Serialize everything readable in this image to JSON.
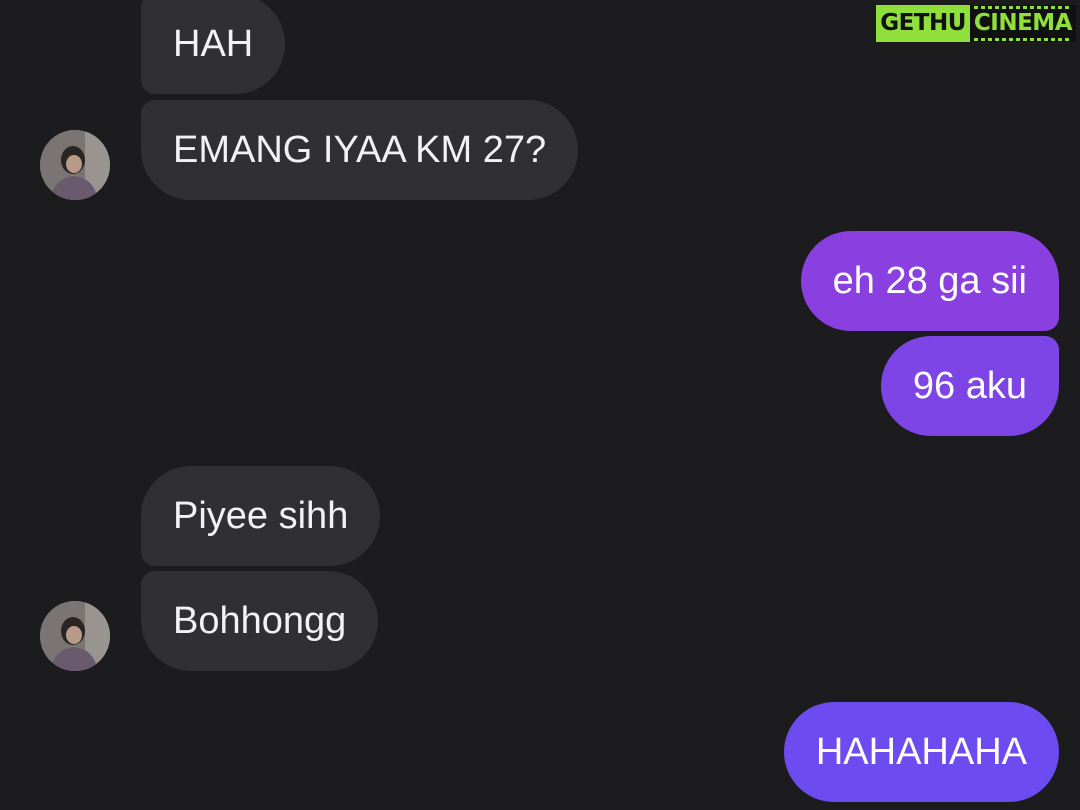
{
  "watermark": {
    "left": "GETHU",
    "right": "CINEMA"
  },
  "conversation": {
    "messages": [
      {
        "direction": "incoming",
        "text": "HAH"
      },
      {
        "direction": "incoming",
        "text": "EMANG IYAA KM 27?"
      },
      {
        "direction": "outgoing",
        "text": "eh 28 ga sii"
      },
      {
        "direction": "outgoing",
        "text": "96 aku"
      },
      {
        "direction": "incoming",
        "text": "Piyee sihh"
      },
      {
        "direction": "incoming",
        "text": "Bohhongg"
      },
      {
        "direction": "outgoing",
        "text": "HAHAHAHA"
      }
    ]
  },
  "colors": {
    "background": "#1c1c1e",
    "incoming_bubble": "#303033",
    "outgoing_bubble_top": "#8a3fe0",
    "outgoing_bubble_bottom": "#6c4cf0",
    "watermark_accent": "#8fe03a"
  },
  "icons": {
    "avatar": "contact-avatar"
  }
}
